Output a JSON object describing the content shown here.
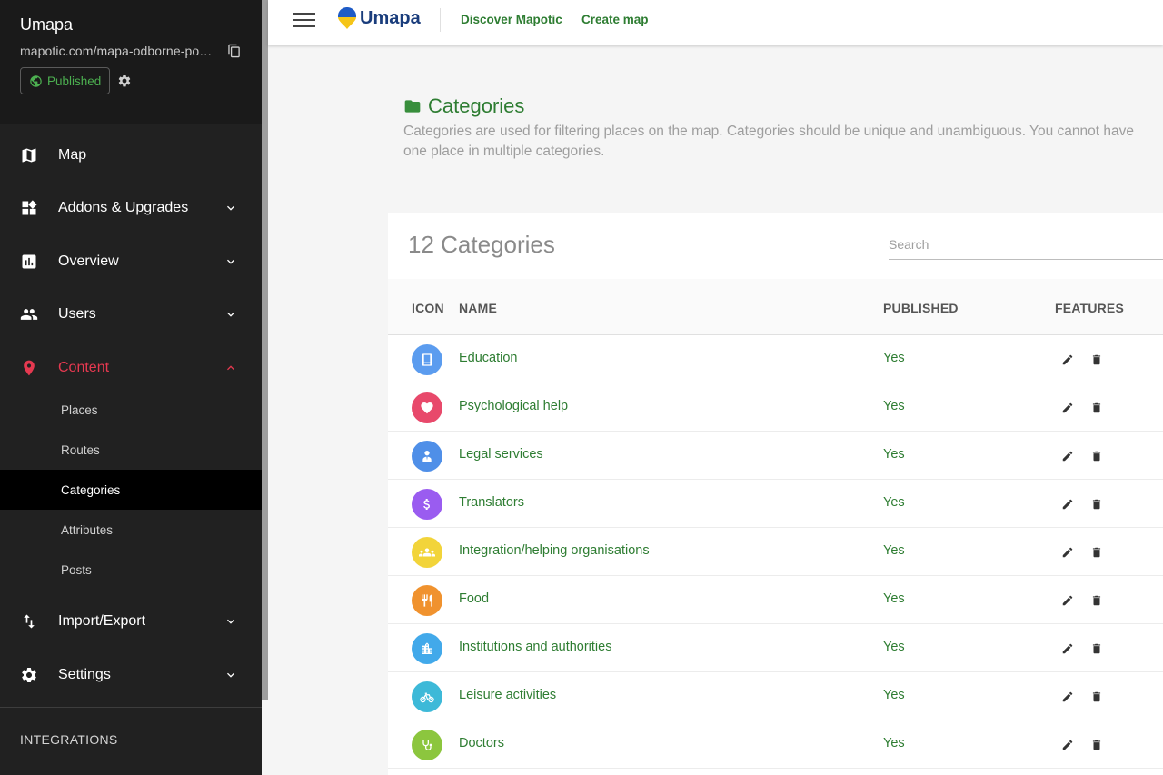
{
  "sidebar": {
    "app_name": "Umapa",
    "map_url": "mapotic.com/mapa-odborne-pomoci-ukrajincum",
    "published_label": "Published",
    "nav": {
      "map": "Map",
      "addons": "Addons & Upgrades",
      "overview": "Overview",
      "users": "Users",
      "content": "Content",
      "import_export": "Import/Export",
      "settings": "Settings"
    },
    "content_sub": {
      "places": "Places",
      "routes": "Routes",
      "categories": "Categories",
      "attributes": "Attributes",
      "posts": "Posts"
    },
    "integrations": "INTEGRATIONS"
  },
  "topbar": {
    "logo_text": "Umapa",
    "discover": "Discover Mapotic",
    "create_map": "Create map"
  },
  "page": {
    "title": "Categories",
    "description": "Categories are used for filtering places on the map. Categories should be unique and unambiguous. You cannot have one place in multiple categories."
  },
  "card": {
    "title": "12 Categories",
    "search_placeholder": "Search",
    "columns": {
      "icon": "ICON",
      "name": "NAME",
      "published": "PUBLISHED",
      "features": "FEATURES"
    }
  },
  "categories": [
    {
      "name": "Education",
      "published": "Yes",
      "icon": "book-icon",
      "color": "#5b9cef"
    },
    {
      "name": "Psychological help",
      "published": "Yes",
      "icon": "heart-icon",
      "color": "#e8496b"
    },
    {
      "name": "Legal services",
      "published": "Yes",
      "icon": "lawyer-icon",
      "color": "#4f8fe8"
    },
    {
      "name": "Translators",
      "published": "Yes",
      "icon": "dollar-icon",
      "color": "#9a5cf0"
    },
    {
      "name": "Integration/helping organisations",
      "published": "Yes",
      "icon": "group-icon",
      "color": "#f2d43a"
    },
    {
      "name": "Food",
      "published": "Yes",
      "icon": "fork-knife-icon",
      "color": "#f0922e"
    },
    {
      "name": "Institutions and authorities",
      "published": "Yes",
      "icon": "building-icon",
      "color": "#42a9ea"
    },
    {
      "name": "Leisure activities",
      "published": "Yes",
      "icon": "bicycle-icon",
      "color": "#3db9d8"
    },
    {
      "name": "Doctors",
      "published": "Yes",
      "icon": "stethoscope-icon",
      "color": "#8cc63e"
    }
  ],
  "colors": {
    "sidebar_bg": "#212121",
    "accent_green": "#2e7d32",
    "active_red": "#e53950",
    "logo_blue": "#1a3d7c",
    "logo_yellow": "#f5c518"
  }
}
